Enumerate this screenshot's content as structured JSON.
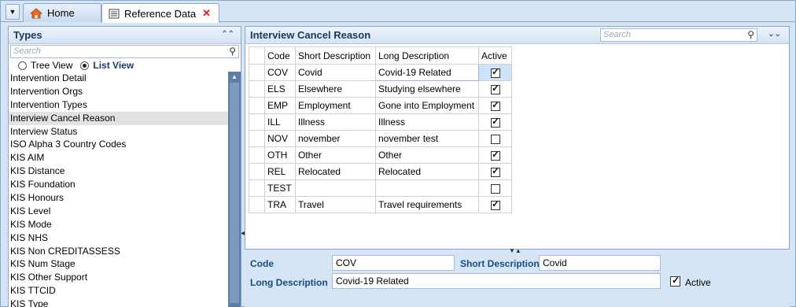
{
  "tabs": {
    "menu_glyph": "▼",
    "home_label": "Home",
    "ref_label": "Reference Data"
  },
  "types_panel": {
    "title": "Types",
    "search_placeholder": "Search",
    "tree_view_label": "Tree View",
    "list_view_label": "List View",
    "selected_view": "List View",
    "items": [
      "Intervention Detail",
      "Intervention Orgs",
      "Intervention Types",
      "Interview Cancel Reason",
      "Interview Status",
      "ISO Alpha 3 Country Codes",
      "KIS AIM",
      "KIS Distance",
      "KIS Foundation",
      "KIS Honours",
      "KIS Level",
      "KIS Mode",
      "KIS NHS",
      "KIS Non CREDITASSESS",
      "KIS Num Stage",
      "KIS Other Support",
      "KIS TTCID",
      "KIS Type"
    ],
    "selected_item": "Interview Cancel Reason"
  },
  "grid_panel": {
    "title": "Interview Cancel Reason",
    "search_placeholder": "Search",
    "columns": [
      "Code",
      "Short Description",
      "Long Description",
      "Active"
    ],
    "rows": [
      {
        "code": "COV",
        "short": "Covid",
        "long": "Covid-19 Related",
        "active": true
      },
      {
        "code": "ELS",
        "short": "Elsewhere",
        "long": "Studying elsewhere",
        "active": true
      },
      {
        "code": "EMP",
        "short": "Employment",
        "long": "Gone into Employment",
        "active": true
      },
      {
        "code": "ILL",
        "short": "Illness",
        "long": "Illness",
        "active": true
      },
      {
        "code": "NOV",
        "short": "november",
        "long": "november test",
        "active": false
      },
      {
        "code": "OTH",
        "short": "Other",
        "long": "Other",
        "active": true
      },
      {
        "code": "REL",
        "short": "Relocated",
        "long": "Relocated",
        "active": true
      },
      {
        "code": "TEST",
        "short": "",
        "long": "",
        "active": false
      },
      {
        "code": "TRA",
        "short": "Travel",
        "long": "Travel requirements",
        "active": true
      }
    ],
    "selected_row": 0
  },
  "detail": {
    "code_label": "Code",
    "code_value": "COV",
    "short_label": "Short Description",
    "short_value": "Covid",
    "long_label": "Long Description",
    "long_value": "Covid-19 Related",
    "active_label": "Active",
    "active": true
  },
  "colors": {
    "header_text": "#1a3a66",
    "label_text": "#1a4a80",
    "scrollbar": "#5d7fa6",
    "close_red": "#d02020"
  }
}
